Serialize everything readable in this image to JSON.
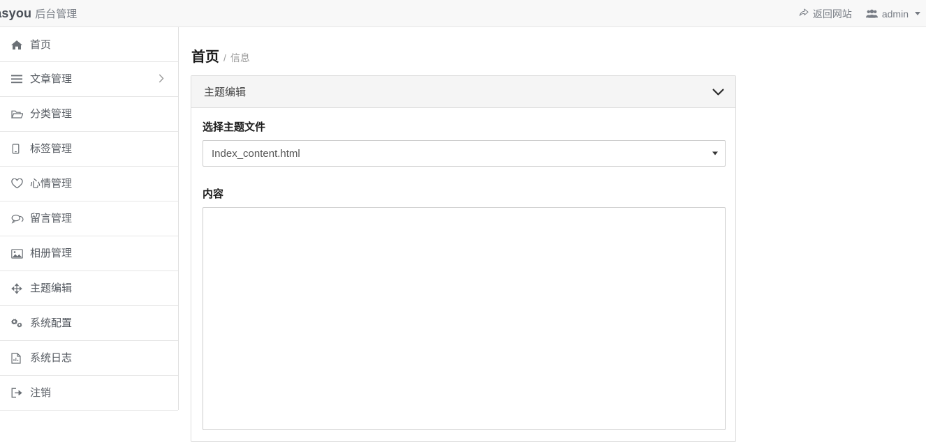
{
  "navbar": {
    "brand_name": "easyou",
    "brand_sub": "后台管理",
    "back_to_site_label": "返回网站",
    "back_to_site_icon": "share-arrow-icon",
    "user_label": "admin",
    "user_icon": "users-icon",
    "caret_icon": "caret-down-icon"
  },
  "sidebar": {
    "items": [
      {
        "label": "首页",
        "icon": "home-icon",
        "has_arrow": false
      },
      {
        "label": "文章管理",
        "icon": "bars-icon",
        "has_arrow": true
      },
      {
        "label": "分类管理",
        "icon": "folder-open-icon",
        "has_arrow": false
      },
      {
        "label": "标签管理",
        "icon": "tag-icon",
        "has_arrow": false
      },
      {
        "label": "心情管理",
        "icon": "heart-icon",
        "has_arrow": false
      },
      {
        "label": "留言管理",
        "icon": "comments-icon",
        "has_arrow": false
      },
      {
        "label": "相册管理",
        "icon": "image-icon",
        "has_arrow": false
      },
      {
        "label": "主题编辑",
        "icon": "move-arrows-icon",
        "has_arrow": false
      },
      {
        "label": "系统配置",
        "icon": "cogs-icon",
        "has_arrow": false
      },
      {
        "label": "系统日志",
        "icon": "file-chart-icon",
        "has_arrow": false
      },
      {
        "label": "注销",
        "icon": "sign-out-icon",
        "has_arrow": false
      }
    ]
  },
  "breadcrumb": {
    "current": "首页",
    "separator": "/",
    "sub": "信息"
  },
  "panel": {
    "title": "主题编辑",
    "collapse_icon": "chevron-down-icon"
  },
  "form": {
    "theme_file_label": "选择主题文件",
    "theme_file_value": "Index_content.html",
    "theme_file_arrow_icon": "caret-down-icon",
    "content_label": "内容",
    "content_value": "",
    "content_placeholder": ""
  },
  "colors": {
    "navbar_bg": "#f8f8f8",
    "panel_head_bg": "#f5f5f5",
    "border": "#dddddd",
    "text": "#333333",
    "muted": "#9a9a9a"
  }
}
